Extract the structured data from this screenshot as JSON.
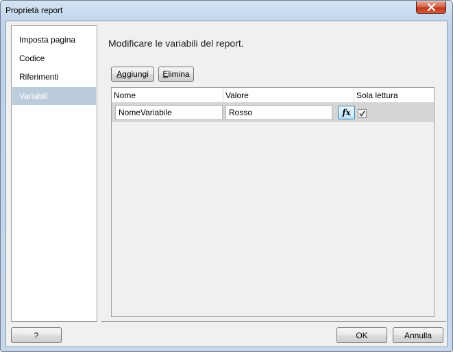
{
  "window": {
    "title": "Proprietà report"
  },
  "nav": {
    "items": [
      {
        "label": "Imposta pagina",
        "selected": false
      },
      {
        "label": "Codice",
        "selected": false
      },
      {
        "label": "Riferimenti",
        "selected": false
      },
      {
        "label": "Variabili",
        "selected": true
      }
    ]
  },
  "main": {
    "heading": "Modificare le variabili del report.",
    "add_button": {
      "accel": "A",
      "rest": "ggiungi"
    },
    "delete_button": {
      "accel": "E",
      "rest": "limina"
    },
    "grid": {
      "columns": [
        "Nome",
        "Valore",
        "Sola lettura"
      ],
      "rows": [
        {
          "name": "NomeVariabile",
          "value": "Rosso",
          "readonly": true
        }
      ],
      "expression_button_label": "fx"
    }
  },
  "footer": {
    "help_label": "?",
    "ok_label": "OK",
    "cancel_label": "Annulla"
  }
}
